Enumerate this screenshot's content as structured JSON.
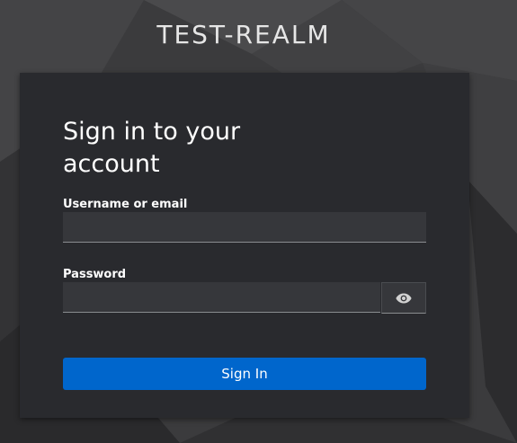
{
  "realm": {
    "title": "TEST-REALM"
  },
  "login": {
    "heading": "Sign in to your account",
    "username_label": "Username or email",
    "username_value": "",
    "password_label": "Password",
    "password_value": "",
    "show_password_icon": "eye-icon",
    "submit_label": "Sign In"
  },
  "colors": {
    "card_background": "#292a2e",
    "input_background": "#36373b",
    "primary_button": "#0066cc",
    "page_background": "#3a3a3c"
  }
}
